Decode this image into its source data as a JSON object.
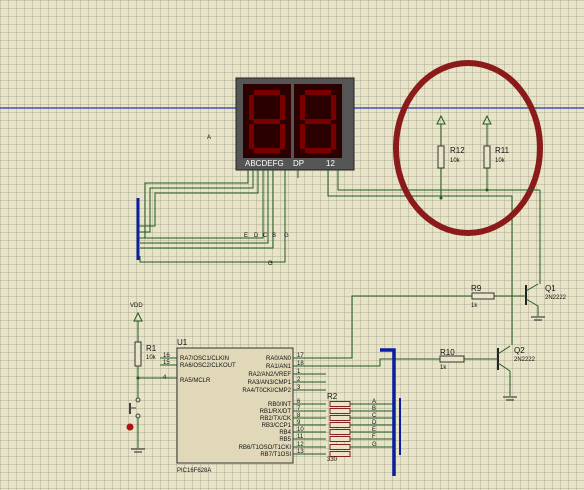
{
  "display": {
    "pin_labels_left": "ABCDEFG",
    "pin_label_dp": "DP",
    "pin_label_digits": "12",
    "side_label": "A"
  },
  "resistors": {
    "r1": {
      "name": "R1",
      "value": "10k"
    },
    "r9": {
      "name": "R9",
      "value": "1k"
    },
    "r10": {
      "name": "R10",
      "value": "1k"
    },
    "r11": {
      "name": "R11",
      "value": "10k"
    },
    "r12": {
      "name": "R12",
      "value": "10k"
    },
    "r2": {
      "name": "R2",
      "value": "330"
    }
  },
  "power": {
    "vdd_label": "VDD"
  },
  "transistors": {
    "q1": {
      "name": "Q1",
      "model": "2N2222"
    },
    "q2": {
      "name": "Q2",
      "model": "2N2222"
    }
  },
  "mcu": {
    "name": "U1",
    "part": "PIC16F628A",
    "left_pins": [
      {
        "num": "16",
        "label": "RA7/OSC1/CLKIN"
      },
      {
        "num": "15",
        "label": "RA6/OSC2/CLKOUT"
      },
      {
        "num": "4",
        "label": "RA5/MCLR"
      }
    ],
    "right_pins": [
      {
        "num": "17",
        "label": "RA0/AN0"
      },
      {
        "num": "18",
        "label": "RA1/AN1"
      },
      {
        "num": "1",
        "label": "RA2/AN2/VREF"
      },
      {
        "num": "2",
        "label": "RA3/AN3/CMP1"
      },
      {
        "num": "3",
        "label": "RA4/T0CKI/CMP2"
      },
      {
        "num": "6",
        "label": "RB0/INT"
      },
      {
        "num": "7",
        "label": "RB1/RX/DT"
      },
      {
        "num": "8",
        "label": "RB2/TX/CK"
      },
      {
        "num": "9",
        "label": "RB3/CCP1"
      },
      {
        "num": "10",
        "label": "RB4"
      },
      {
        "num": "11",
        "label": "RB5"
      },
      {
        "num": "12",
        "label": "RB6/T1OSO/T1CKI"
      },
      {
        "num": "13",
        "label": "RB7/T1OSI"
      }
    ]
  },
  "bus_labels_left": [
    "A",
    "B",
    "C",
    "D",
    "E",
    "F",
    "G"
  ],
  "bus_labels_left_bottom": "G",
  "net_labels_right": [
    "A",
    "B",
    "C",
    "D",
    "E",
    "F",
    "G"
  ],
  "colors": {
    "background": "#e8e4c8",
    "wire": "#1e5a1e",
    "bus": "#0a1fa0",
    "highlight_ellipse": "#8b1a1a",
    "display_body": "#5a5a5a",
    "segment": "#7a0000"
  }
}
